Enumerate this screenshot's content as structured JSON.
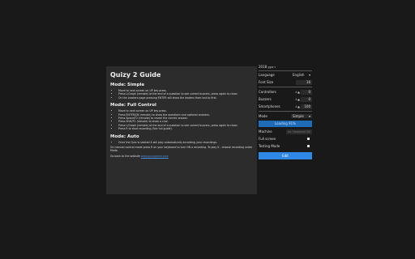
{
  "guide": {
    "title": "Quizy 2 Guide",
    "sections": [
      {
        "heading": "Mode: Simple",
        "items": [
          "Move to next screen on UP key press.",
          "Press L/Graph (remote) at the end of a question to see correct buzzers, press again to close.",
          "On the Leaders page pressing ENTER will show the leaders from last to first."
        ]
      },
      {
        "heading": "Mode: Full Control",
        "items": [
          "Move to next screen on UP key press.",
          "Press ENTER/OK (remote) to show the questions and optional answers.",
          "Press Space/F2 (remote) to reveal the correct answer.",
          "Press Shift/F1 (remote) to show a clue.",
          "Press L/Graph (remote) at the end of a question to see correct buzzers, press again to close.",
          "Press R to start recording (See full guide)."
        ]
      },
      {
        "heading": "Mode: Auto",
        "items": [
          "Once the Quiz is started it will play automatically according your recordings."
        ]
      }
    ],
    "note": "On manual control mode press R on your keyboard to turn ON a recording. To play it - choose recording under Mode.",
    "back_text": "Go back to the website",
    "back_link": "www.quizygame.com"
  },
  "panel": {
    "title": "2018 רבעון",
    "language_label": "Language",
    "language_value": "English",
    "fontsize_label": "Font Size",
    "fontsize_value": "16",
    "controllers_label": "Controllers",
    "controllers_value": "0",
    "buzzers_label": "Buzzers",
    "buzzers_value": "0",
    "smartphones_label": "Smartphones",
    "smartphones_value": "100",
    "mode_label": "Mode",
    "mode_value": "Simple",
    "loading_text": "Loading 91%",
    "machine_label": "Machine",
    "machine_placeholder": "ex. Headroid 0000",
    "fullscreen_label": "Full screen",
    "testing_label": "Testing Mode",
    "edit_label": "Edit",
    "accent_color": "#2f87e6"
  }
}
